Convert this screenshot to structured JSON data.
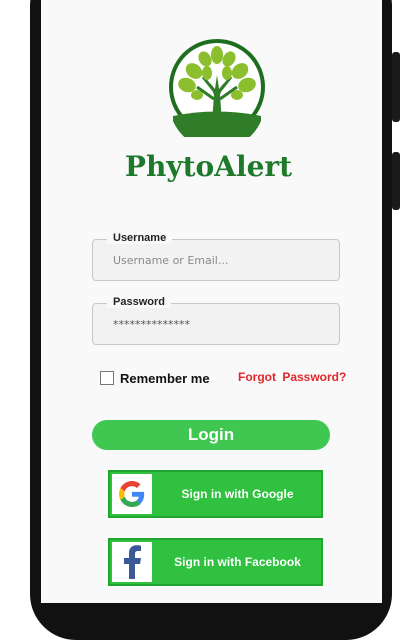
{
  "app": {
    "title": "PhytoAlert"
  },
  "login_form": {
    "username": {
      "label": "Username",
      "placeholder": "Username or Email..."
    },
    "password": {
      "label": "Password",
      "value": "**************"
    },
    "remember_label": "Remember me",
    "remember_checked": false,
    "forgot_label": "Forgot  Password?",
    "login_label": "Login"
  },
  "social": {
    "google_label": "Sign in with Google",
    "facebook_label": "Sign in with Facebook"
  },
  "colors": {
    "brand_green": "#1e7a2a",
    "button_green": "#3fc751",
    "social_green": "#2fc13f",
    "forgot_red": "#e0282b"
  },
  "icons": {
    "logo": "tree-logo-icon",
    "google": "google-icon",
    "facebook": "facebook-icon"
  }
}
